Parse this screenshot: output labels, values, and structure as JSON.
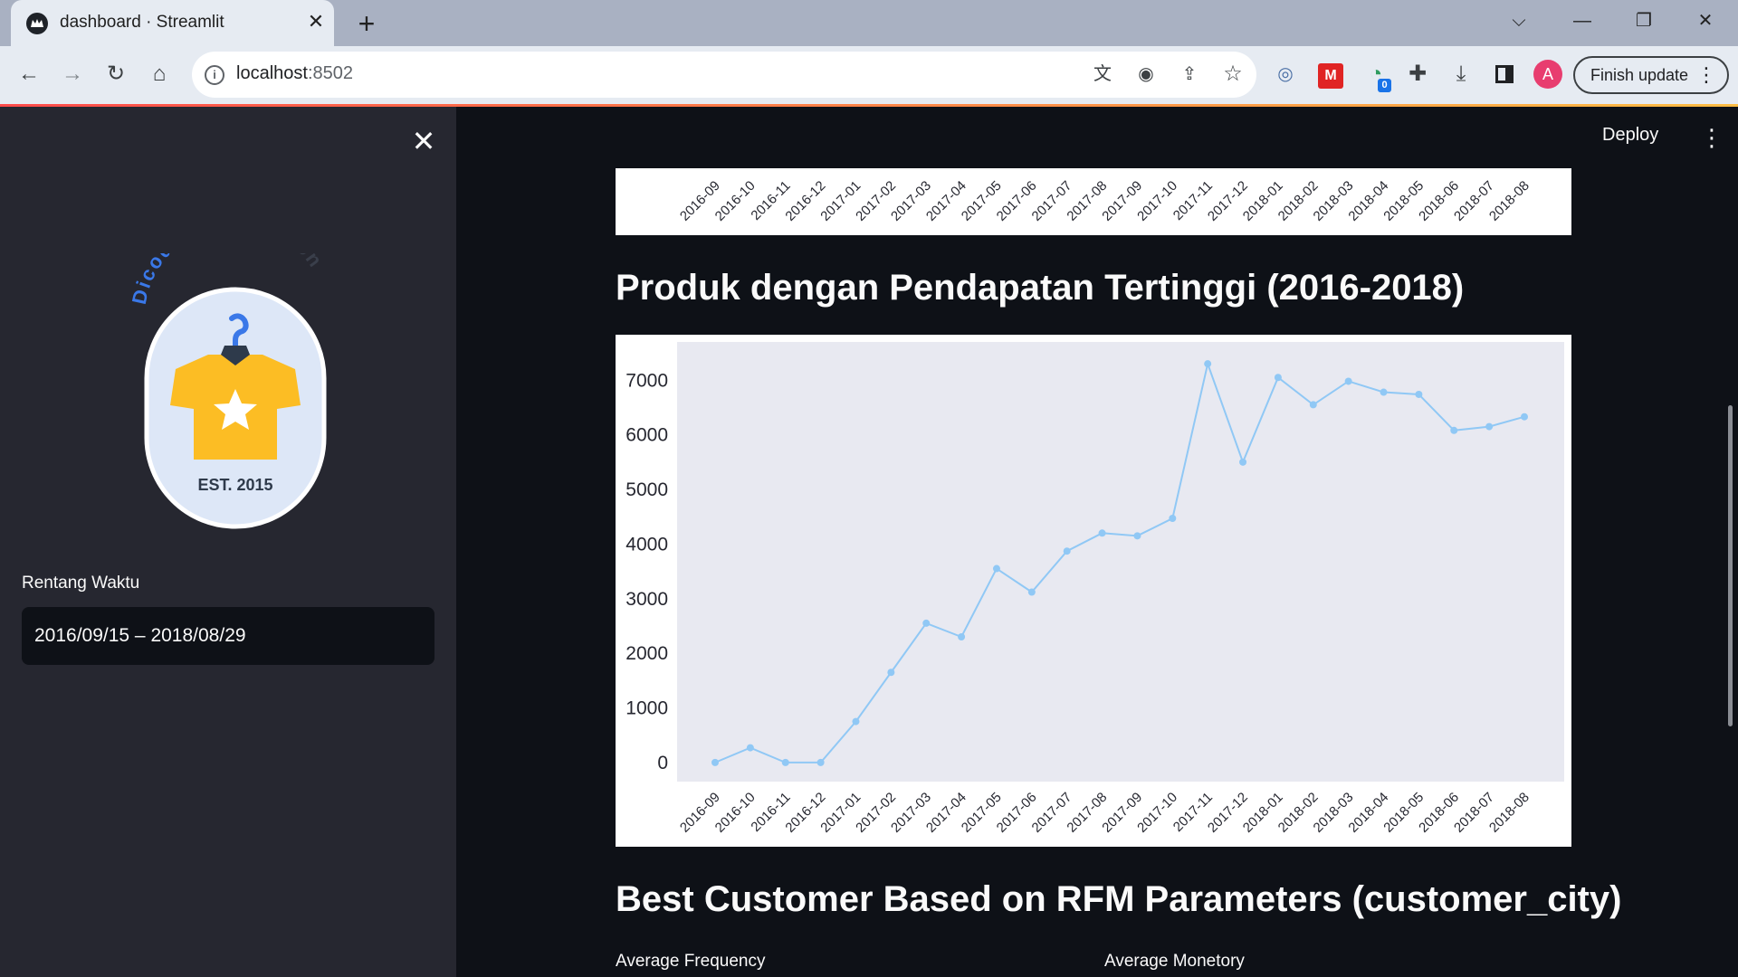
{
  "browser": {
    "tab_title": "dashboard · Streamlit",
    "url_host": "localhost",
    "url_port": ":8502",
    "finish_update_label": "Finish update",
    "avatar_letter": "A",
    "extension_badge": "0"
  },
  "sidebar": {
    "logo_text_top": "Dicoding",
    "logo_text_right": "Collection",
    "logo_est": "EST. 2015",
    "date_label": "Rentang Waktu",
    "date_value": "2016/09/15 – 2018/08/29"
  },
  "header": {
    "deploy_label": "Deploy"
  },
  "main": {
    "section_title": "Produk dengan Pendapatan Tertinggi (2016-2018)",
    "next_title": "Best Customer Based on RFM Parameters (customer_city)",
    "metric_freq_label": "Average Frequency",
    "metric_mon_label": "Average Monetory"
  },
  "colors": {
    "line": "#90c8f5",
    "plot_bg": "#e8e9f1",
    "accent": "#ff4b4b"
  },
  "chart_data": {
    "type": "line",
    "categories": [
      "2016-09",
      "2016-10",
      "2016-11",
      "2016-12",
      "2017-01",
      "2017-02",
      "2017-03",
      "2017-04",
      "2017-05",
      "2017-06",
      "2017-07",
      "2017-08",
      "2017-09",
      "2017-10",
      "2017-11",
      "2017-12",
      "2018-01",
      "2018-02",
      "2018-03",
      "2018-04",
      "2018-05",
      "2018-06",
      "2018-07",
      "2018-08"
    ],
    "values": [
      0,
      270,
      0,
      0,
      750,
      1650,
      2550,
      2300,
      3550,
      3120,
      3870,
      4200,
      4150,
      4470,
      7300,
      5500,
      7050,
      6550,
      6980,
      6780,
      6740,
      6080,
      6150,
      6330
    ],
    "yticks": [
      0,
      1000,
      2000,
      3000,
      4000,
      5000,
      6000,
      7000
    ],
    "ylim": [
      -350,
      7700
    ],
    "grid": false,
    "title": "",
    "xlabel": "",
    "ylabel": ""
  }
}
